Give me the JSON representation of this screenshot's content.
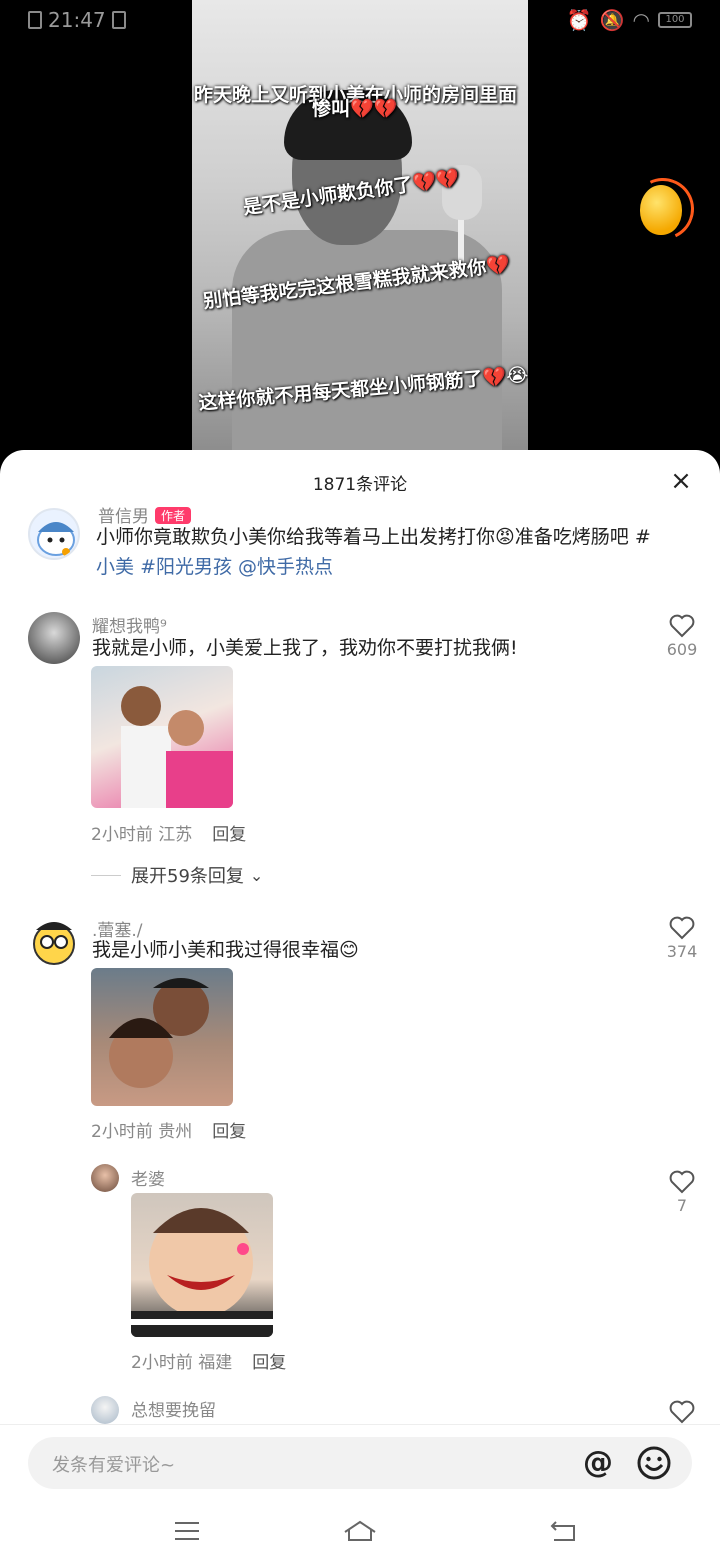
{
  "status_bar": {
    "time": "21:47",
    "battery": "100"
  },
  "video": {
    "captions": [
      "昨天晚上又听到小美在小师的房间里面",
      "惨叫💔💔",
      "是不是小师欺负你了💔💔",
      "别怕等我吃完这根雪糕我就来救你💔",
      "这样你就不用每天都坐小师钢筋了💔😭"
    ]
  },
  "sheet": {
    "title": "1871条评论",
    "close_label": "×"
  },
  "author_comment": {
    "username": "普信男",
    "badge": "作者",
    "text_main": "小师你竟敢欺负小美你给我等着马上出发拷打你😡准备吃烤肠吧 #",
    "tag1": "小美",
    "tag2": "#阳光男孩",
    "mention": "@快手热点"
  },
  "comments": [
    {
      "username": "耀想我鸭⁹",
      "text": "我就是小师，小美爱上我了，我劝你不要打扰我俩!",
      "time": "2小时前",
      "location": "江苏",
      "reply": "回复",
      "likes": "609",
      "expand": "展开59条回复"
    },
    {
      "username": ".蕾塞./",
      "text": "我是小师小美和我过得很幸福😊",
      "time": "2小时前",
      "location": "贵州",
      "reply": "回复",
      "likes": "374"
    }
  ],
  "replies": [
    {
      "username": "老婆",
      "time": "2小时前",
      "location": "福建",
      "reply": "回复",
      "likes": "7"
    },
    {
      "username": "总想要挽留"
    }
  ],
  "input": {
    "placeholder": "发条有爱评论~",
    "at_label": "@"
  },
  "colors": {
    "tag": "#3f6aa6",
    "badge": "#ff3b6b",
    "accent": "#ff5a1a"
  }
}
